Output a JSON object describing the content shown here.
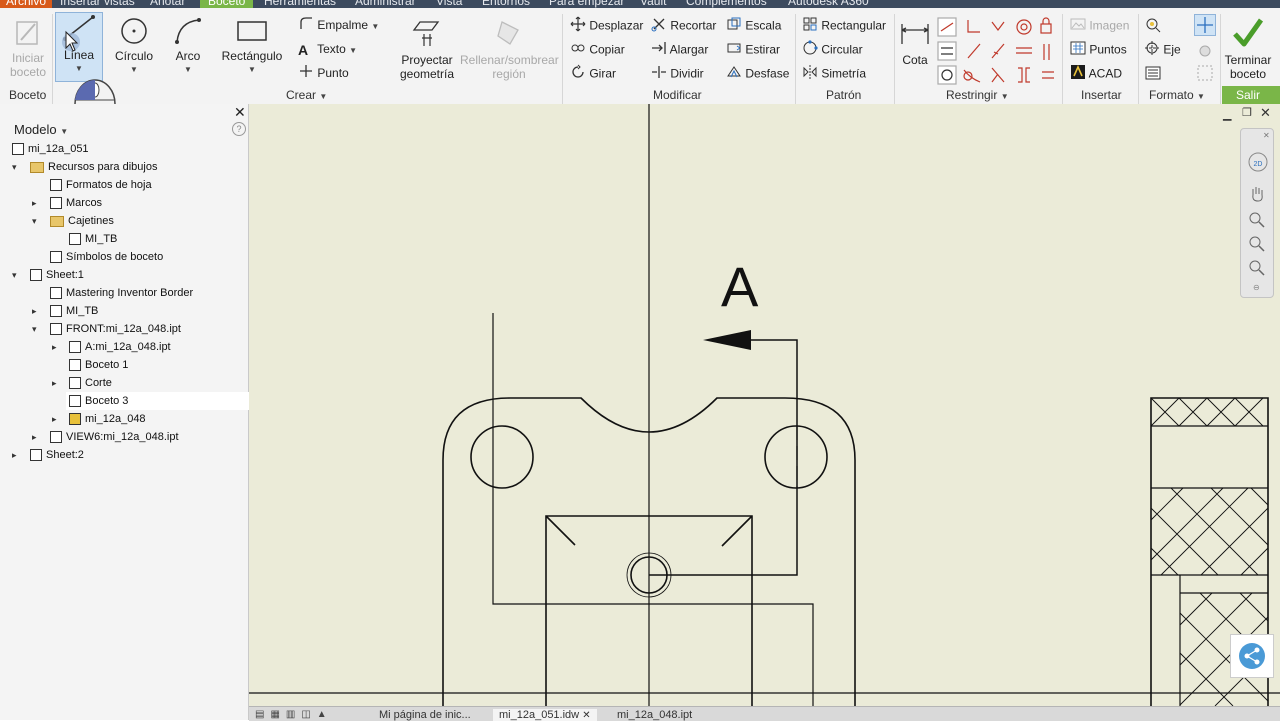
{
  "menu": {
    "tabs": [
      "Archivo",
      "Insertar vistas",
      "Anotar",
      "Boceto",
      "Herramientas",
      "Administrar",
      "Vista",
      "Entornos",
      "Para empezar",
      "Vault",
      "Complementos",
      "Autodesk A360"
    ]
  },
  "ribbon": {
    "boceto_group": {
      "iniciar_boceto": "Iniciar boceto",
      "label": "Boceto"
    },
    "crear_group": {
      "linea": "Línea",
      "circulo": "Círculo",
      "arco": "Arco",
      "rectangulo": "Rectángulo",
      "empalme": "Empalme",
      "texto": "Texto",
      "punto": "Punto",
      "proyectar": "Proyectar geometría",
      "rellenar": "Rellenar/sombrear región",
      "label": "Crear"
    },
    "modificar_group": {
      "desplazar": "Desplazar",
      "copiar": "Copiar",
      "girar": "Girar",
      "recortar": "Recortar",
      "alargar": "Alargar",
      "dividir": "Dividir",
      "escala": "Escala",
      "estirar": "Estirar",
      "desfase": "Desfase",
      "label": "Modificar"
    },
    "patron_group": {
      "rectangular": "Rectangular",
      "circular": "Circular",
      "simetria": "Simetría",
      "label": "Patrón"
    },
    "restringir_group": {
      "cota": "Cota",
      "label": "Restringir"
    },
    "insertar_group": {
      "imagen": "Imagen",
      "puntos": "Puntos",
      "acad": "ACAD",
      "label": "Insertar"
    },
    "formato_group": {
      "eje": "Eje",
      "label": "Formato"
    },
    "salir_group": {
      "terminar": "Terminar boceto",
      "label": "Salir"
    }
  },
  "browser": {
    "title": "Modelo",
    "items": [
      {
        "label": "mi_12a_051"
      },
      {
        "label": "Recursos para dibujos"
      },
      {
        "label": "Formatos de hoja"
      },
      {
        "label": "Marcos"
      },
      {
        "label": "Cajetines"
      },
      {
        "label": "MI_TB"
      },
      {
        "label": "Símbolos de boceto"
      },
      {
        "label": "Sheet:1"
      },
      {
        "label": "Mastering Inventor Border"
      },
      {
        "label": "MI_TB"
      },
      {
        "label": "FRONT:mi_12a_048.ipt"
      },
      {
        "label": "A:mi_12a_048.ipt"
      },
      {
        "label": "Boceto 1"
      },
      {
        "label": "Corte"
      },
      {
        "label": "Boceto 3"
      },
      {
        "label": "mi_12a_048"
      },
      {
        "label": "VIEW6:mi_12a_048.ipt"
      },
      {
        "label": "Sheet:2"
      }
    ]
  },
  "canvas": {
    "section_label": "A"
  },
  "doc_tabs": [
    "Mi página de inic...",
    "mi_12a_051.idw",
    "mi_12a_048.ipt"
  ],
  "colors": {
    "canvas_bg": "#ebebd8",
    "accent_green": "#7ab648",
    "file_orange": "#d85a1a"
  }
}
